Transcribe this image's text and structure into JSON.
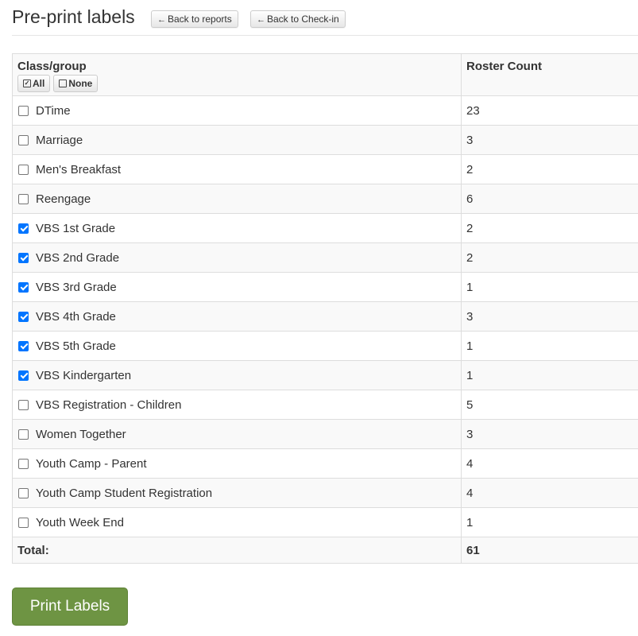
{
  "header": {
    "title": "Pre-print labels",
    "back_reports_label": "Back to reports",
    "back_checkin_label": "Back to Check-in",
    "back_icon": "arrow-left-icon"
  },
  "table": {
    "columns": [
      "Class/group",
      "Roster Count"
    ],
    "select_all_label": "All",
    "select_none_label": "None",
    "rows": [
      {
        "label": "DTime",
        "count": "23",
        "checked": false
      },
      {
        "label": "Marriage",
        "count": "3",
        "checked": false
      },
      {
        "label": "Men's Breakfast",
        "count": "2",
        "checked": false
      },
      {
        "label": "Reengage",
        "count": "6",
        "checked": false
      },
      {
        "label": "VBS 1st Grade",
        "count": "2",
        "checked": true
      },
      {
        "label": "VBS 2nd Grade",
        "count": "2",
        "checked": true
      },
      {
        "label": "VBS 3rd Grade",
        "count": "1",
        "checked": true
      },
      {
        "label": "VBS 4th Grade",
        "count": "3",
        "checked": true
      },
      {
        "label": "VBS 5th Grade",
        "count": "1",
        "checked": true
      },
      {
        "label": "VBS Kindergarten",
        "count": "1",
        "checked": true
      },
      {
        "label": "VBS Registration - Children",
        "count": "5",
        "checked": false
      },
      {
        "label": "Women Together",
        "count": "3",
        "checked": false
      },
      {
        "label": "Youth Camp - Parent",
        "count": "4",
        "checked": false
      },
      {
        "label": "Youth Camp Student Registration",
        "count": "4",
        "checked": false
      },
      {
        "label": "Youth Week End",
        "count": "1",
        "checked": false
      }
    ],
    "total_label": "Total:",
    "total_value": "61"
  },
  "actions": {
    "print_label": "Print Labels"
  },
  "colors": {
    "print_button": "#6e9443",
    "checkbox_checked": "#0075ff"
  }
}
